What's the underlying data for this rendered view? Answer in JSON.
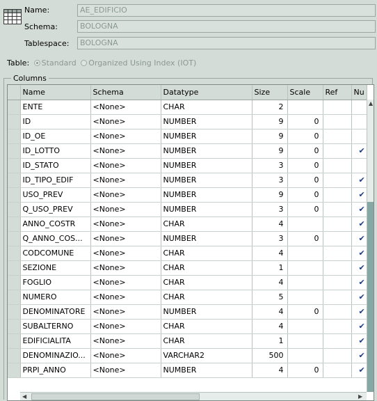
{
  "object": {
    "name_label": "Name:",
    "name_value": "AE_EDIFICIO",
    "schema_label": "Schema:",
    "schema_value": "BOLOGNA",
    "tablespace_label": "Tablespace:",
    "tablespace_value": "BOLOGNA"
  },
  "table_type": {
    "label": "Table:",
    "standard": "Standard",
    "iot": "Organized Using Index (IOT)"
  },
  "columns_group": "Columns",
  "headers": [
    "Name",
    "Schema",
    "Datatype",
    "Size",
    "Scale",
    "Ref",
    "Nu"
  ],
  "rows": [
    {
      "name": "ENTE",
      "schema": "<None>",
      "datatype": "CHAR",
      "size": "2",
      "scale": "",
      "ref": "",
      "nul": ""
    },
    {
      "name": "ID",
      "schema": "<None>",
      "datatype": "NUMBER",
      "size": "9",
      "scale": "0",
      "ref": "",
      "nul": ""
    },
    {
      "name": "ID_OE",
      "schema": "<None>",
      "datatype": "NUMBER",
      "size": "9",
      "scale": "0",
      "ref": "",
      "nul": ""
    },
    {
      "name": "ID_LOTTO",
      "schema": "<None>",
      "datatype": "NUMBER",
      "size": "9",
      "scale": "0",
      "ref": "",
      "nul": "✔"
    },
    {
      "name": "ID_STATO",
      "schema": "<None>",
      "datatype": "NUMBER",
      "size": "3",
      "scale": "0",
      "ref": "",
      "nul": ""
    },
    {
      "name": "ID_TIPO_EDIF",
      "schema": "<None>",
      "datatype": "NUMBER",
      "size": "3",
      "scale": "0",
      "ref": "",
      "nul": "✔"
    },
    {
      "name": "USO_PREV",
      "schema": "<None>",
      "datatype": "NUMBER",
      "size": "9",
      "scale": "0",
      "ref": "",
      "nul": "✔"
    },
    {
      "name": "Q_USO_PREV",
      "schema": "<None>",
      "datatype": "NUMBER",
      "size": "3",
      "scale": "0",
      "ref": "",
      "nul": "✔"
    },
    {
      "name": "ANNO_COSTR",
      "schema": "<None>",
      "datatype": "CHAR",
      "size": "4",
      "scale": "",
      "ref": "",
      "nul": "✔"
    },
    {
      "name": "Q_ANNO_COS...",
      "schema": "<None>",
      "datatype": "NUMBER",
      "size": "3",
      "scale": "0",
      "ref": "",
      "nul": "✔"
    },
    {
      "name": "CODCOMUNE",
      "schema": "<None>",
      "datatype": "CHAR",
      "size": "4",
      "scale": "",
      "ref": "",
      "nul": "✔"
    },
    {
      "name": "SEZIONE",
      "schema": "<None>",
      "datatype": "CHAR",
      "size": "1",
      "scale": "",
      "ref": "",
      "nul": "✔"
    },
    {
      "name": "FOGLIO",
      "schema": "<None>",
      "datatype": "CHAR",
      "size": "4",
      "scale": "",
      "ref": "",
      "nul": "✔"
    },
    {
      "name": "NUMERO",
      "schema": "<None>",
      "datatype": "CHAR",
      "size": "5",
      "scale": "",
      "ref": "",
      "nul": "✔"
    },
    {
      "name": "DENOMINATORE",
      "schema": "<None>",
      "datatype": "NUMBER",
      "size": "4",
      "scale": "0",
      "ref": "",
      "nul": "✔"
    },
    {
      "name": "SUBALTERNO",
      "schema": "<None>",
      "datatype": "CHAR",
      "size": "4",
      "scale": "",
      "ref": "",
      "nul": "✔"
    },
    {
      "name": "EDIFICIALITA",
      "schema": "<None>",
      "datatype": "CHAR",
      "size": "1",
      "scale": "",
      "ref": "",
      "nul": "✔"
    },
    {
      "name": "DENOMINAZIO...",
      "schema": "<None>",
      "datatype": "VARCHAR2",
      "size": "500",
      "scale": "",
      "ref": "",
      "nul": "✔"
    },
    {
      "name": "PRPI_ANNO",
      "schema": "<None>",
      "datatype": "NUMBER",
      "size": "4",
      "scale": "0",
      "ref": "",
      "nul": "✔"
    }
  ],
  "icons": {
    "table": "table-grid-icon",
    "up": "scroll-up-arrow-icon",
    "left": "scroll-left-arrow-icon",
    "right": "scroll-right-arrow-icon"
  }
}
